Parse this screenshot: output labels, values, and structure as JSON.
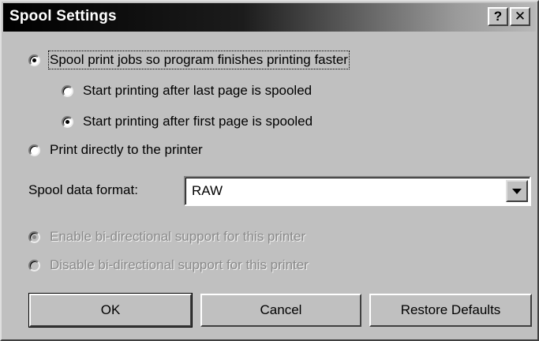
{
  "window": {
    "title": "Spool Settings",
    "help_glyph": "?",
    "close_glyph": "✕"
  },
  "spool_options": {
    "spool_jobs": {
      "label": "Spool print jobs so program finishes printing faster",
      "checked": true
    },
    "start_after_last": {
      "label": "Start printing after last page is spooled",
      "checked": false
    },
    "start_after_first": {
      "label": "Start printing after first page is spooled",
      "checked": true
    },
    "print_direct": {
      "label": "Print directly to the printer",
      "checked": false
    }
  },
  "data_format": {
    "label": "Spool data format:",
    "value": "RAW"
  },
  "bidi_options": {
    "enable": {
      "label": "Enable bi-directional support for this printer",
      "checked": true,
      "disabled": true
    },
    "disable": {
      "label": "Disable bi-directional support for this printer",
      "checked": false,
      "disabled": true
    }
  },
  "buttons": {
    "ok": "OK",
    "cancel": "Cancel",
    "restore": "Restore Defaults"
  },
  "colors": {
    "dialog_face": "#c0c0c0",
    "titlebar_start": "#000000",
    "titlebar_end": "#b8b8b8",
    "disabled_text": "#8a8a8a"
  },
  "icons": {
    "help": "question-mark",
    "close": "x-close",
    "dropdown": "down-triangle"
  }
}
